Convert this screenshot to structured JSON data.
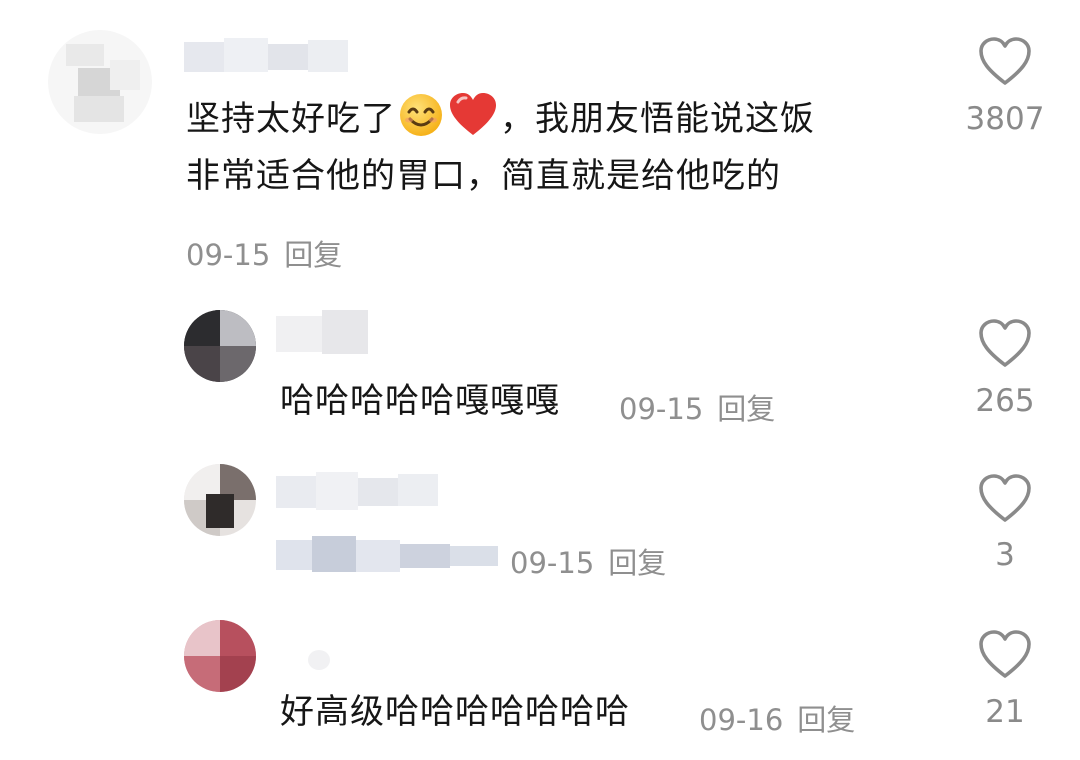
{
  "comments": [
    {
      "text_line1_before": "坚持太好吃了",
      "emoji1": "smiling-face",
      "emoji2": "red-heart",
      "text_line1_after": "，我朋友悟能说这饭",
      "text_line2": "非常适合他的胃口，简直就是给他吃的",
      "date": "09-15",
      "reply_label": "回复",
      "likes": "3807"
    }
  ],
  "replies": [
    {
      "text": "哈哈哈哈哈嘎嘎嘎",
      "date": "09-15",
      "reply_label": "回复",
      "likes": "265"
    },
    {
      "text": "",
      "date": "09-15",
      "reply_label": "回复",
      "likes": "3"
    },
    {
      "text": "好高级哈哈哈哈哈哈哈",
      "date": "09-16",
      "reply_label": "回复",
      "likes": "21"
    }
  ],
  "icons": {
    "like": "heart-outline-icon"
  },
  "colors": {
    "meta_gray": "#8f8f8f",
    "text": "#161616",
    "heart": "#e53935"
  }
}
